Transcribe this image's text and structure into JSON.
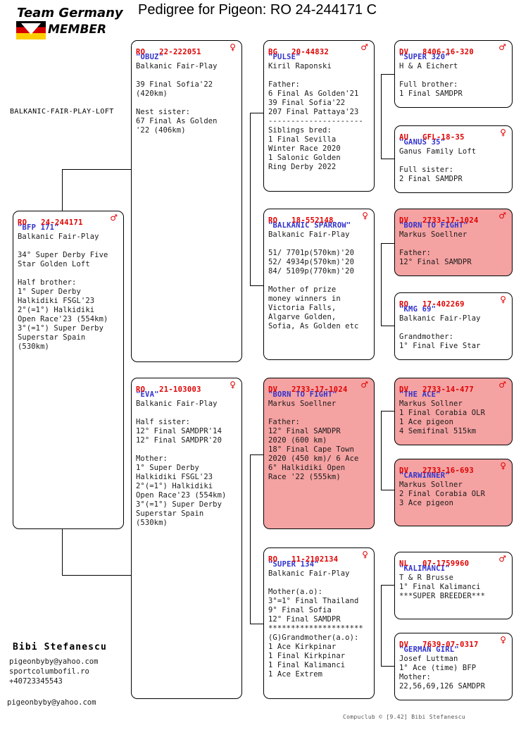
{
  "logo": {
    "line1": "Team Germany",
    "line2": "MEMBER",
    "flag_colors": [
      "#000000",
      "#d40000",
      "#ffce00"
    ]
  },
  "title": "Pedigree for Pigeon: RO  24-244171 C",
  "loft_label": "BALKANIC-FAIR-PLAY-LOFT",
  "colors": {
    "ring_red": "#e00000",
    "name_blue": "#3333cc",
    "pink_card": "#f5a2a2",
    "text": "#1a1a1a"
  },
  "footer": {
    "owner": "Bibi Stefanescu",
    "contact_lines": "pigeonbyby@yahoo.com\nsportcolumbofil.ro\n+40723345543",
    "contact_email2": "pigeonbyby@yahoo.com",
    "compuclub": "Compuclub © [9.42]  Bibi Stefanescu"
  },
  "cards": {
    "subject": {
      "ring": "RO   24-244171",
      "sex": "♂",
      "name": "\"BFP 171\"",
      "lines": "Balkanic Fair-Play\n\n34° Super Derby Five\nStar Golden Loft\n\nHalf brother:\n1° Super Derby\nHalkidiki FSGL'23\n2°(=1°) Halkidiki\nOpen Race'23 (554km)\n3°(=1°) Super Derby\nSuperstar Spain\n(530km)"
    },
    "sire": {
      "ring": "RO   22-222051",
      "sex": "♀",
      "name": "\"OBUZ\"",
      "lines": "Balkanic Fair-Play\n\n39 Final Sofia'22\n(420km)\n\nNest sister:\n67 Final As Golden\n'22 (406km)"
    },
    "dam": {
      "ring": "RO   21-103003",
      "sex": "♀",
      "name": "\"EVA\"",
      "lines": "Balkanic Fair-Play\n\nHalf sister:\n12° Final SAMDPR'14\n12° Final SAMDPR'20\n\nMother:\n1° Super Derby\nHalkidiki FSGL'23\n2°(=1°) Halkidiki\nOpen Race'23 (554km)\n3°(=1°) Super Derby\nSuperstar Spain\n(530km)"
    },
    "gp1": {
      "ring": "BG   20-44832",
      "sex": "♂",
      "name": "\"PULSE\"",
      "lines": "Kiril Raponski\n\nFather:\n6 Final As Golden'21\n39 Final Sofia'22\n207 Final Pattaya'23\n---------------------\nSiblings bred:\n1 Final Sevilla\nWinter Race 2020\n1 Salonic Golden\nRing Derby 2022"
    },
    "gp2": {
      "ring": "RO   18-552148",
      "sex": "♀",
      "name": "\"BALKANIC SPARROW\"",
      "lines": "Balkanic Fair-Play\n\n51/ 7701p(570km)'20\n52/ 4934p(570km)'20\n84/ 5109p(770km)'20\n\nMother of prize\nmoney winners in\nVictoria Falls,\nAlgarve Golden,\nSofia, As Golden etc"
    },
    "gp3": {
      "ring": "DV   2733-17-1024",
      "sex": "♂",
      "name": "\"BORN TO FIGHT\"",
      "pink": true,
      "lines": "Markus Soellner\n\nFather:\n12° Final SAMDPR\n2020 (600 km)\n18° Final Cape Town\n2020 (450 km)/ 6 Ace\n6° Halkidiki Open\nRace '22 (555km)"
    },
    "gp4": {
      "ring": "RO   11-2102134",
      "sex": "♀",
      "name": "\"SUPER 134\"",
      "lines": "Balkanic Fair-Play\n\nMother(a.o):\n3°=1° Final Thailand\n9° Final Sofia\n12° Final SAMDPR\n*********************\n(G)Grandmother(a.o):\n1 Ace Kirkpinar\n1 Final Kirkpinar\n1 Final Kalimanci\n1 Ace Extrem"
    },
    "ggp1": {
      "ring": "DV   8406-16-320",
      "sex": "♂",
      "name": "\"SUPER 320\"",
      "lines": "H & A Eichert\n\nFull brother:\n1 Final SAMDPR"
    },
    "ggp2": {
      "ring": "AU   GFL-18-35",
      "sex": "♀",
      "name": "\"GANUS 35\"",
      "lines": "Ganus Family Loft\n\nFull sister:\n2 Final SAMDPR"
    },
    "ggp3": {
      "ring": "DV   2733-17-1024",
      "sex": "♂",
      "name": "\"BORN TO FIGHT\"",
      "pink": true,
      "lines": "Markus Soellner\n\nFather:\n12° Final SAMDPR"
    },
    "ggp4": {
      "ring": "RO   17-402269",
      "sex": "♀",
      "name": "\"KMG 69\"",
      "lines": "Balkanic Fair-Play\n\nGrandmother:\n1° Final Five Star"
    },
    "ggp5": {
      "ring": "DV   2733-14-477",
      "sex": "♂",
      "name": "\"THE ACE\"",
      "pink": true,
      "lines": "Markus Sollner\n1 Final Corabia OLR\n1 Ace pigeon\n4 Semifinal 515km"
    },
    "ggp6": {
      "ring": "DV   2733-16-693",
      "sex": "♀",
      "name": "\"CARWINNER\"",
      "pink": true,
      "lines": "Markus Sollner\n2 Final Corabia OLR\n3 Ace pigeon"
    },
    "ggp7": {
      "ring": "NL   07-1759960",
      "sex": "♂",
      "name": "\"KALIMANCI\"",
      "lines": "T & R Brusse\n1° Final Kalimanci\n***SUPER BREEDER***"
    },
    "ggp8": {
      "ring": "DV   7639-07-0317",
      "sex": "♀",
      "name": "\"GERMAN GIRL\"",
      "lines": "Josef Luttman\n1° Ace (time) BFP\nMother:\n22,56,69,126 SAMDPR"
    }
  }
}
